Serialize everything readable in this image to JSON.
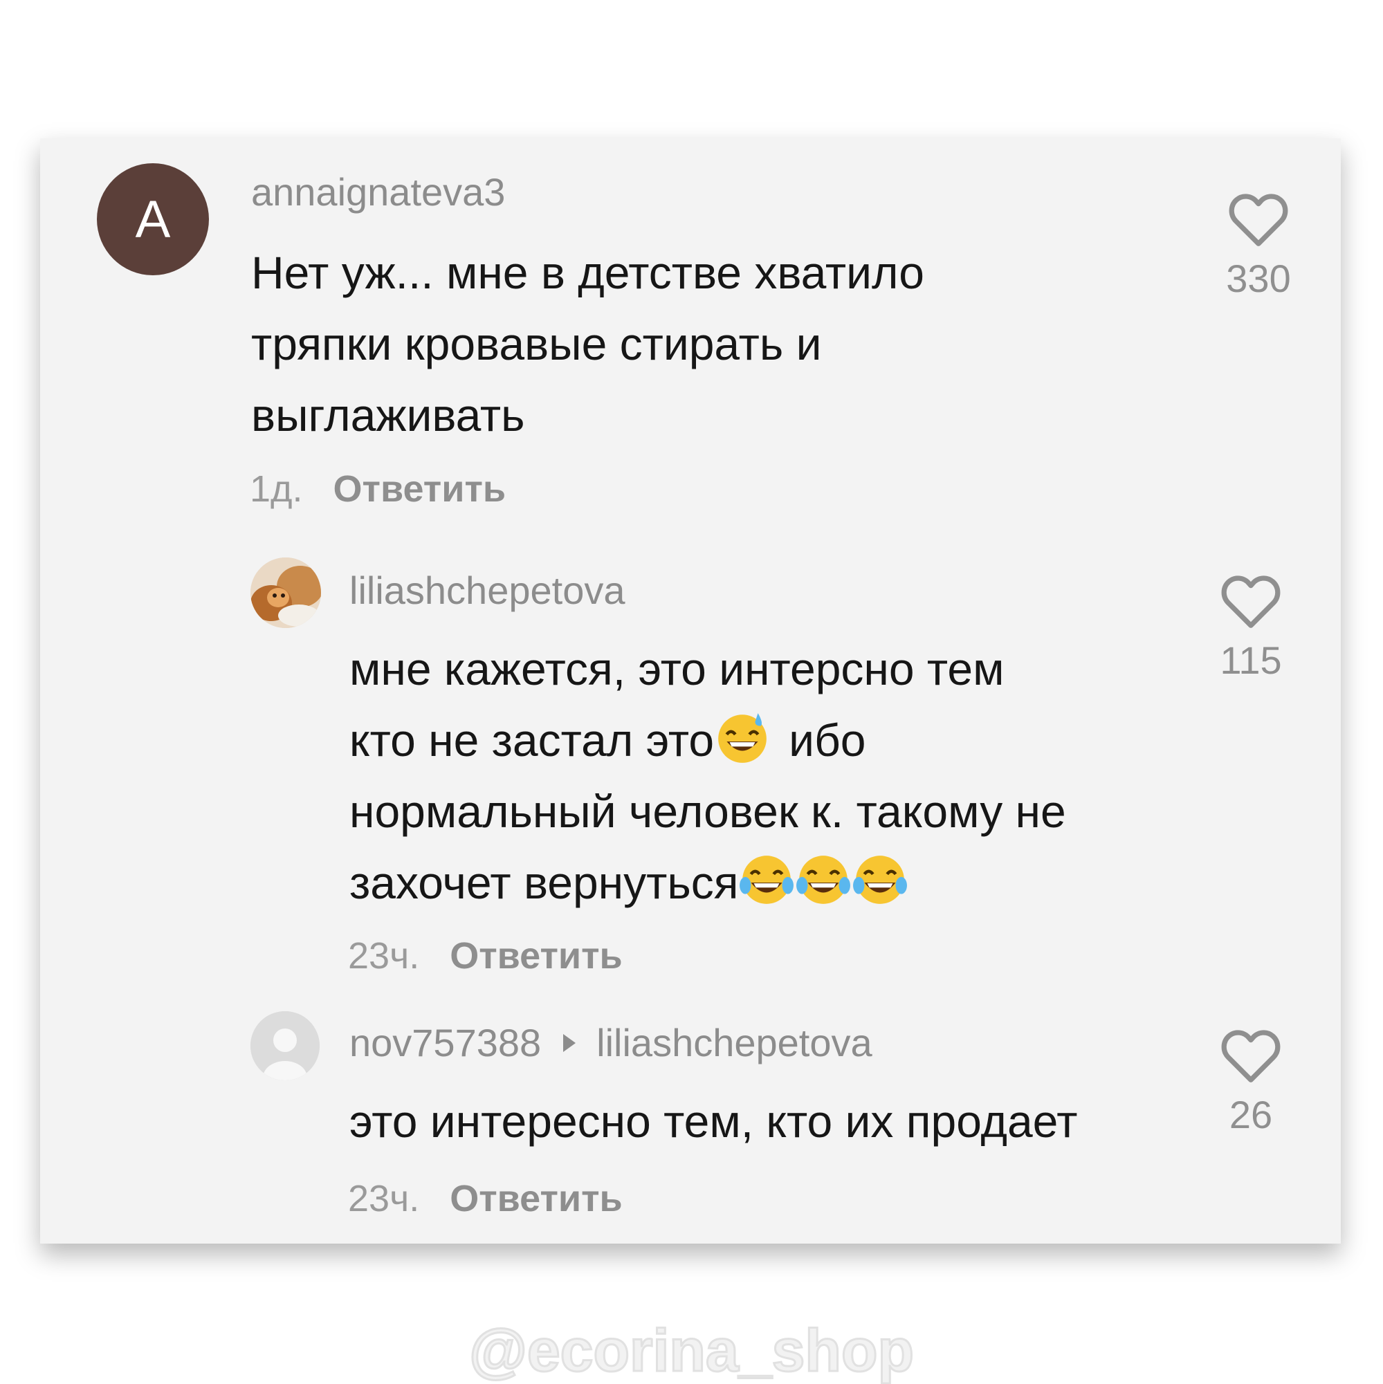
{
  "comments": [
    {
      "avatar_letter": "A",
      "username": "annaignateva3",
      "text_lines": [
        "Нет уж... мне в детстве хватило",
        "тряпки кровавые стирать и",
        "выглаживать"
      ],
      "time": "1д.",
      "reply_label": "Ответить",
      "likes": "330"
    },
    {
      "username": "liliashchepetova",
      "text_lines": [
        "мне кажется, это интерсно тем",
        "кто не застал это",
        "ибо",
        "нормальный человек к. такому не",
        "захочет вернуться"
      ],
      "emoji_names": [
        "grinning-sweat-emoji",
        "tears-of-joy-emoji",
        "tears-of-joy-emoji",
        "tears-of-joy-emoji"
      ],
      "time": "23ч.",
      "reply_label": "Ответить",
      "likes": "115"
    },
    {
      "username": "nov757388",
      "reply_to": "liliashchepetova",
      "text": "это интересно тем, кто их продает",
      "time": "23ч.",
      "reply_label": "Ответить",
      "likes": "26"
    }
  ],
  "watermark": "@ecorina_shop",
  "colors": {
    "card_bg": "#f3f3f3",
    "avatar_a": "#5b3f39",
    "username": "#8c8c8c",
    "text": "#161616"
  }
}
